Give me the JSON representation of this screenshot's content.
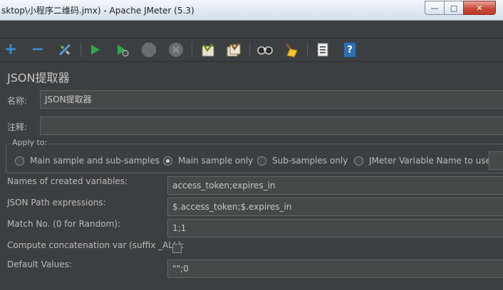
{
  "window": {
    "title": "sktop\\小程序二维码.jmx) - Apache JMeter (5.3)",
    "controls": {
      "minimize": "—",
      "maximize": "□",
      "close": "✕"
    }
  },
  "toolbar": {
    "icons": [
      "add-icon",
      "remove-icon",
      "toggle-icon",
      "start-icon",
      "start-no-pause-icon",
      "stop-icon",
      "shutdown-icon",
      "clear-icon",
      "clear-all-icon",
      "search-icon",
      "reset-search-icon",
      "function-helper-icon",
      "help-icon"
    ],
    "glyphs": {
      "add": "+",
      "remove": "−",
      "help": "?"
    }
  },
  "panel": {
    "title": "JSON提取器",
    "name_label": "名称:",
    "name_value": "JSON提取器",
    "comment_label": "注释:",
    "comment_value": ""
  },
  "apply_to": {
    "title": "Apply to:",
    "options": [
      {
        "label": "Main sample and sub-samples",
        "selected": false
      },
      {
        "label": "Main sample only",
        "selected": true
      },
      {
        "label": "Sub-samples only",
        "selected": false
      },
      {
        "label": "JMeter Variable Name to use",
        "selected": false
      }
    ]
  },
  "fields": {
    "var_names_label": "Names of created variables:",
    "var_names_value": "access_token;expires_in",
    "json_path_label": "JSON Path expressions:",
    "json_path_value": "$.access_token;$.expires_in",
    "match_no_label": "Match No. (0 for Random):",
    "match_no_value": "1;1",
    "concat_label": "Compute concatenation var (suffix _ALL):",
    "concat_checked": false,
    "defaults_label": "Default Values:",
    "defaults_value": "\"\";0"
  },
  "colors": {
    "background": "#3c3f41",
    "field_bg": "#45494a",
    "text": "#bbbbbb",
    "run_green": "#2fa84f",
    "add_blue": "#3d8fd6"
  }
}
